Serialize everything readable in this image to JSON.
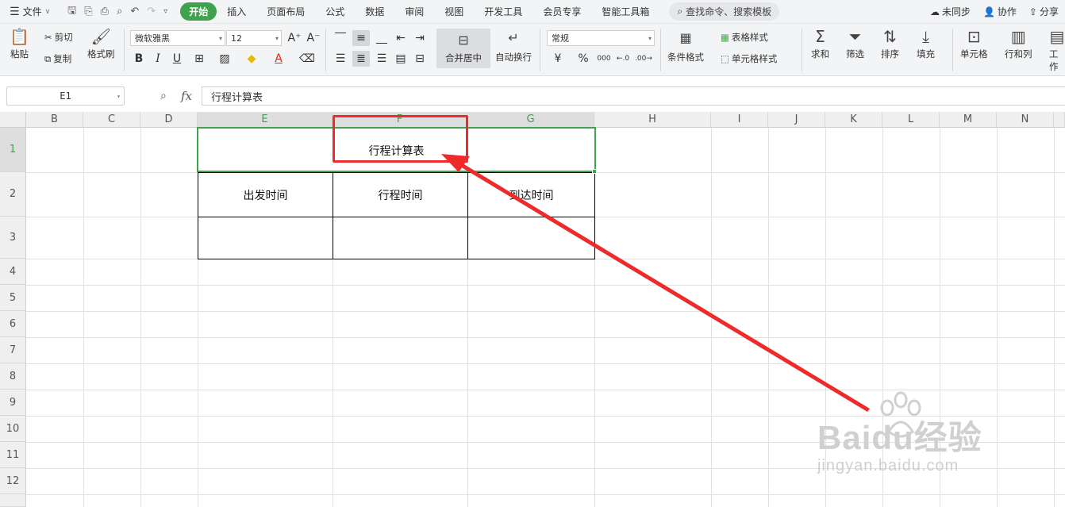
{
  "menubar": {
    "file_label": "文件",
    "tabs": [
      {
        "label": "开始",
        "active": true
      },
      {
        "label": "插入"
      },
      {
        "label": "页面布局"
      },
      {
        "label": "公式"
      },
      {
        "label": "数据"
      },
      {
        "label": "审阅"
      },
      {
        "label": "视图"
      },
      {
        "label": "开发工具"
      },
      {
        "label": "会员专享"
      },
      {
        "label": "智能工具箱"
      }
    ],
    "search_placeholder": "查找命令、搜索模板",
    "sync_label": "未同步",
    "collab_label": "协作",
    "share_label": "分享"
  },
  "ribbon": {
    "paste": "粘贴",
    "cut": "剪切",
    "copy": "复制",
    "format_painter": "格式刷",
    "font_name": "微软雅黑",
    "font_size": "12",
    "merge_center": "合并居中",
    "wrap_text": "自动换行",
    "number_format": "常规",
    "currency_symbol": "¥",
    "percent_symbol": "%",
    "thousands_symbol": "000",
    "conditional_format": "条件格式",
    "table_style": "表格样式",
    "cell_style": "单元格样式",
    "sum": "求和",
    "filter": "筛选",
    "sort": "排序",
    "fill": "填充",
    "cell": "单元格",
    "row_col": "行和列",
    "worksheet": "工作"
  },
  "formula_bar": {
    "cell_ref": "E1",
    "fx": "fx",
    "content": "行程计算表"
  },
  "sheet": {
    "columns": [
      "B",
      "C",
      "D",
      "E",
      "F",
      "G",
      "H",
      "I",
      "J",
      "K",
      "L",
      "M",
      "N"
    ],
    "rows": [
      "1",
      "2",
      "3",
      "4",
      "5",
      "6",
      "7",
      "8",
      "9",
      "10",
      "11",
      "12"
    ],
    "title": "行程计算表",
    "headers": [
      "出发时间",
      "行程时间",
      "到达时间"
    ]
  },
  "watermark": {
    "brand": "Baidu经验",
    "url": "jingyan.baidu.com"
  },
  "colors": {
    "accent": "#3fa34d",
    "annotation": "#ee2a2a"
  }
}
